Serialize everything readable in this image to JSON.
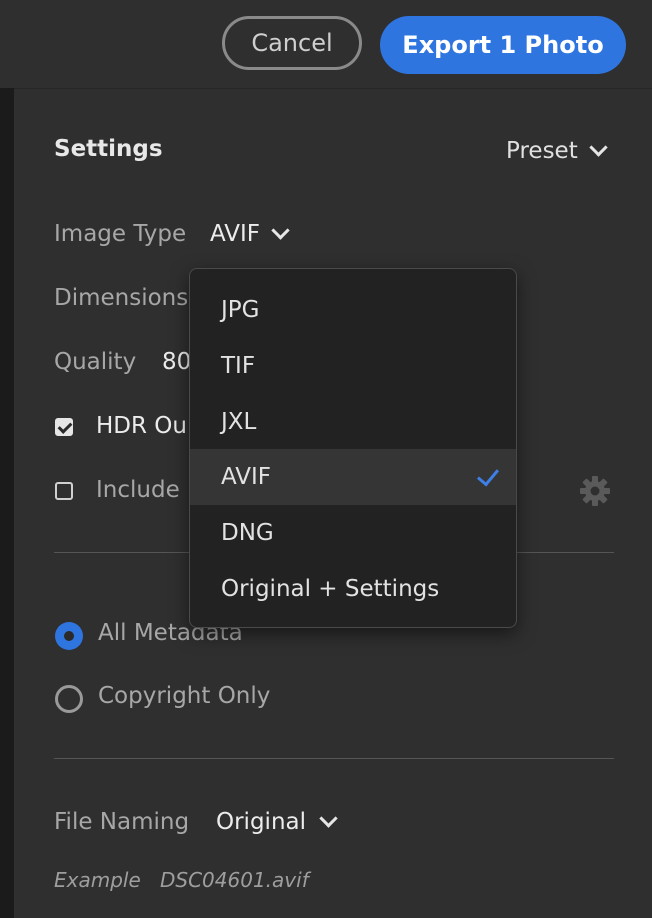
{
  "header": {
    "cancel_label": "Cancel",
    "export_label": "Export 1 Photo"
  },
  "settings": {
    "title": "Settings",
    "preset_label": "Preset",
    "image_type_label": "Image Type",
    "image_type_value": "AVIF",
    "dimensions_label": "Dimensions",
    "quality_label": "Quality",
    "quality_value": "80",
    "hdr_label": "HDR Ou",
    "hdr_checked": true,
    "include_label": "Include",
    "include_checked": false
  },
  "image_type_menu": {
    "options": [
      "JPG",
      "TIF",
      "JXL",
      "AVIF",
      "DNG",
      "Original + Settings"
    ],
    "selected": "AVIF"
  },
  "metadata": {
    "options": [
      "All Metadata",
      "Copyright Only"
    ],
    "selected": "All Metadata"
  },
  "file_naming": {
    "label": "File Naming",
    "value": "Original",
    "example_label": "Example",
    "example_value": "DSC04601.avif"
  },
  "colors": {
    "accent": "#2e75e0",
    "background": "#2f2f2f",
    "menu_background": "#222222"
  }
}
